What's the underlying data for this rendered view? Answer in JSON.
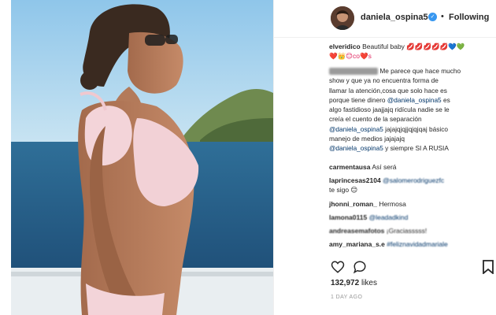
{
  "header": {
    "username": "daniela_ospina5",
    "separator": "•",
    "follow_label": "Following"
  },
  "comments": [
    {
      "user": "elveridico",
      "text": "Beautiful baby",
      "emoji": "💋💋💋💋💋💙💚",
      "line2": "❤️👑😊co❤️s"
    },
    {
      "user": "",
      "text_lines": [
        "Me parece que hace mucho",
        "show y que ya no encuentra forma de",
        "llamar la atención,cosa que solo hace es",
        "porque tiene dinero",
        "algo fastidioso jaajjajq ridícula nadie se le",
        "creía el cuento de la separación",
        "jajajqjqjjqjqjqaj básico",
        "manejo de medios jajajajq",
        "y siempre SI A RUSIA"
      ],
      "mention": "@daniela_ospina5",
      "line4_tail": "es"
    },
    {
      "user": "carmentausa",
      "text": "Así será"
    },
    {
      "user": "laprincesas2104",
      "text": "@salomerodriguezfc",
      "line2": "te sigo 😊"
    },
    {
      "user": "jhonni_roman_",
      "text": "Hermosa"
    },
    {
      "user": "lamona0115",
      "text": "@leadadkind"
    },
    {
      "user": "andreasemafotos",
      "text": "¡Graciasssss!"
    },
    {
      "user": "amy_mariana_s.e",
      "text": "#feliznavidadmariale"
    }
  ],
  "actions": {
    "like_icon": "heart-icon",
    "comment_icon": "comment-icon",
    "save_icon": "bookmark-icon"
  },
  "likes": {
    "count": "132,972",
    "label": "likes"
  },
  "timestamp": "1 DAY AGO",
  "colors": {
    "link": "#003569",
    "verified": "#3897f0",
    "border": "#efefef",
    "muted": "#999999"
  }
}
